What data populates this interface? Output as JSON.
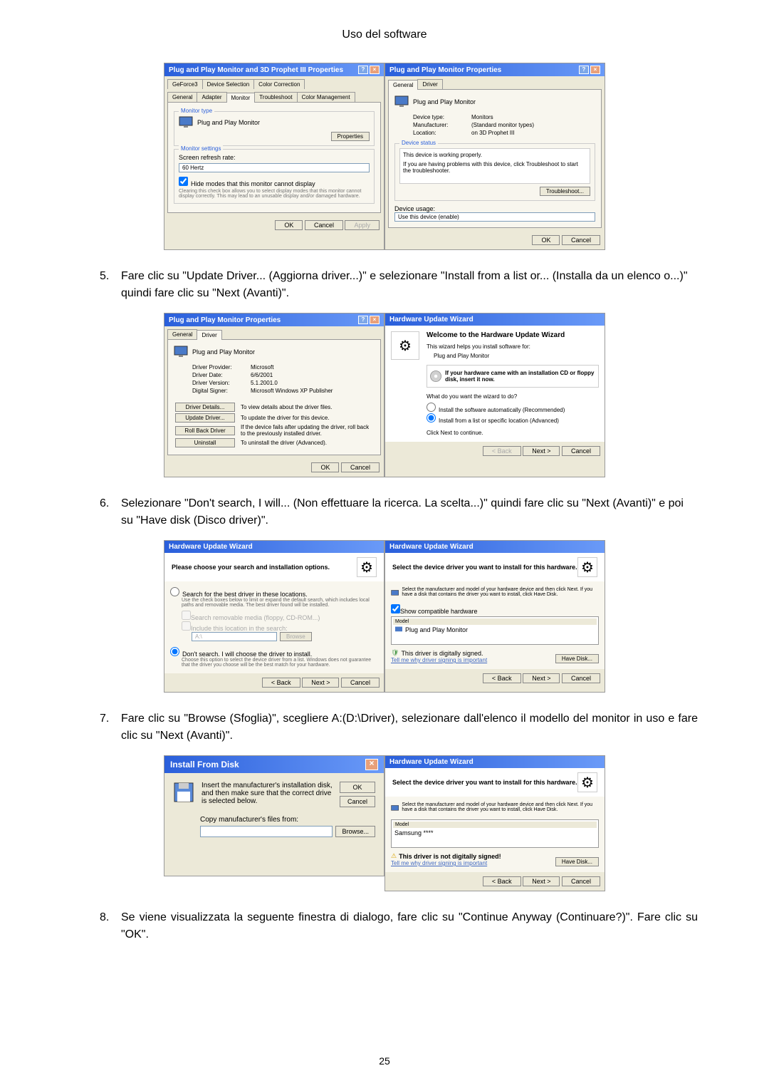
{
  "page": {
    "title": "Uso del software",
    "number": "25"
  },
  "steps": {
    "s5": {
      "num": "5.",
      "text": "Fare clic su \"Update Driver... (Aggiorna driver...)\" e selezionare \"Install from a list or... (Installa da un elenco o...)\" quindi fare clic su \"Next (Avanti)\"."
    },
    "s6": {
      "num": "6.",
      "text": "Selezionare \"Don't search, I will... (Non effettuare la ricerca. La scelta...)\" quindi fare clic su \"Next (Avanti)\" e poi su \"Have disk (Disco driver)\"."
    },
    "s7": {
      "num": "7.",
      "text": "Fare clic su \"Browse (Sfoglia)\", scegliere A:(D:\\Driver), selezionare dall'elenco il modello del monitor in uso e fare clic su \"Next (Avanti)\"."
    },
    "s8": {
      "num": "8.",
      "text": "Se viene visualizzata la seguente finestra di dialogo, fare clic su \"Continue Anyway (Continuare?)\". Fare clic su \"OK\"."
    }
  },
  "fig1a": {
    "title": "Plug and Play Monitor and 3D Prophet III Properties",
    "tab_geforce": "GeForce3",
    "tab_devsel": "Device Selection",
    "tab_colorc": "Color Correction",
    "tab_general": "General",
    "tab_adapter": "Adapter",
    "tab_monitor": "Monitor",
    "tab_trouble": "Troubleshoot",
    "tab_colorm": "Color Management",
    "group_type": "Monitor type",
    "monitor_name": "Plug and Play Monitor",
    "btn_props": "Properties",
    "group_settings": "Monitor settings",
    "lbl_refresh": "Screen refresh rate:",
    "val_refresh": "60 Hertz",
    "chk_hide": "Hide modes that this monitor cannot display",
    "hide_note": "Clearing this check box allows you to select display modes that this monitor cannot display correctly. This may lead to an unusable display and/or damaged hardware.",
    "btn_ok": "OK",
    "btn_cancel": "Cancel",
    "btn_apply": "Apply"
  },
  "fig1b": {
    "title": "Plug and Play Monitor Properties",
    "tab_general": "General",
    "tab_driver": "Driver",
    "device": "Plug and Play Monitor",
    "lbl_type": "Device type:",
    "val_type": "Monitors",
    "lbl_manu": "Manufacturer:",
    "val_manu": "(Standard monitor types)",
    "lbl_loc": "Location:",
    "val_loc": "on 3D Prophet III",
    "group_status": "Device status",
    "status_line": "This device is working properly.",
    "status_note": "If you are having problems with this device, click Troubleshoot to start the troubleshooter.",
    "btn_trouble": "Troubleshoot...",
    "lbl_usage": "Device usage:",
    "val_usage": "Use this device (enable)",
    "btn_ok": "OK",
    "btn_cancel": "Cancel"
  },
  "fig2a": {
    "title": "Plug and Play Monitor Properties",
    "tab_general": "General",
    "tab_driver": "Driver",
    "device": "Plug and Play Monitor",
    "lbl_provider": "Driver Provider:",
    "val_provider": "Microsoft",
    "lbl_date": "Driver Date:",
    "val_date": "6/6/2001",
    "lbl_version": "Driver Version:",
    "val_version": "5.1.2001.0",
    "lbl_signer": "Digital Signer:",
    "val_signer": "Microsoft Windows XP Publisher",
    "btn_details": "Driver Details...",
    "details_note": "To view details about the driver files.",
    "btn_update": "Update Driver...",
    "update_note": "To update the driver for this device.",
    "btn_rollback": "Roll Back Driver",
    "rollback_note": "If the device fails after updating the driver, roll back to the previously installed driver.",
    "btn_uninstall": "Uninstall",
    "uninstall_note": "To uninstall the driver (Advanced).",
    "btn_ok": "OK",
    "btn_cancel": "Cancel"
  },
  "fig2b": {
    "title": "Hardware Update Wizard",
    "welcome": "Welcome to the Hardware Update Wizard",
    "wiz_note": "This wizard helps you install software for:",
    "device": "Plug and Play Monitor",
    "cd_note": "If your hardware came with an installation CD or floppy disk, insert it now.",
    "question": "What do you want the wizard to do?",
    "radio_auto": "Install the software automatically (Recommended)",
    "radio_list": "Install from a list or specific location (Advanced)",
    "click_next": "Click Next to continue.",
    "btn_back": "< Back",
    "btn_next": "Next >",
    "btn_cancel": "Cancel"
  },
  "fig3a": {
    "title": "Hardware Update Wizard",
    "heading": "Please choose your search and installation options.",
    "radio_search": "Search for the best driver in these locations.",
    "search_note": "Use the check boxes below to limit or expand the default search, which includes local paths and removable media. The best driver found will be installed.",
    "chk_removable": "Search removable media (floppy, CD-ROM...)",
    "chk_include": "Include this location in the search:",
    "val_path": "A:\\",
    "btn_browse1": "Browse",
    "radio_dont": "Don't search. I will choose the driver to install.",
    "dont_note": "Choose this option to select the device driver from a list. Windows does not guarantee that the driver you choose will be the best match for your hardware.",
    "btn_back": "< Back",
    "btn_next": "Next >",
    "btn_cancel": "Cancel"
  },
  "fig3b": {
    "title": "Hardware Update Wizard",
    "heading": "Select the device driver you want to install for this hardware.",
    "instruction": "Select the manufacturer and model of your hardware device and then click Next. If you have a disk that contains the driver you want to install, click Have Disk.",
    "chk_compat": "Show compatible hardware",
    "lbl_model": "Model",
    "model_item": "Plug and Play Monitor",
    "signed": "This driver is digitally signed.",
    "tell_why": "Tell me why driver signing is important",
    "btn_havedisk": "Have Disk...",
    "btn_back": "< Back",
    "btn_next": "Next >",
    "btn_cancel": "Cancel"
  },
  "fig4a": {
    "title": "Install From Disk",
    "instruction": "Insert the manufacturer's installation disk, and then make sure that the correct drive is selected below.",
    "btn_ok": "OK",
    "btn_cancel": "Cancel",
    "lbl_copy": "Copy manufacturer's files from:",
    "btn_browse": "Browse..."
  },
  "fig4b": {
    "title": "Hardware Update Wizard",
    "heading": "Select the device driver you want to install for this hardware.",
    "instruction": "Select the manufacturer and model of your hardware device and then click Next. If you have a disk that contains the driver you want to install, click Have Disk.",
    "lbl_model": "Model",
    "model_item": "Samsung ****",
    "not_signed": "This driver is not digitally signed!",
    "tell_why": "Tell me why driver signing is important",
    "btn_havedisk": "Have Disk...",
    "btn_back": "< Back",
    "btn_next": "Next >",
    "btn_cancel": "Cancel"
  }
}
